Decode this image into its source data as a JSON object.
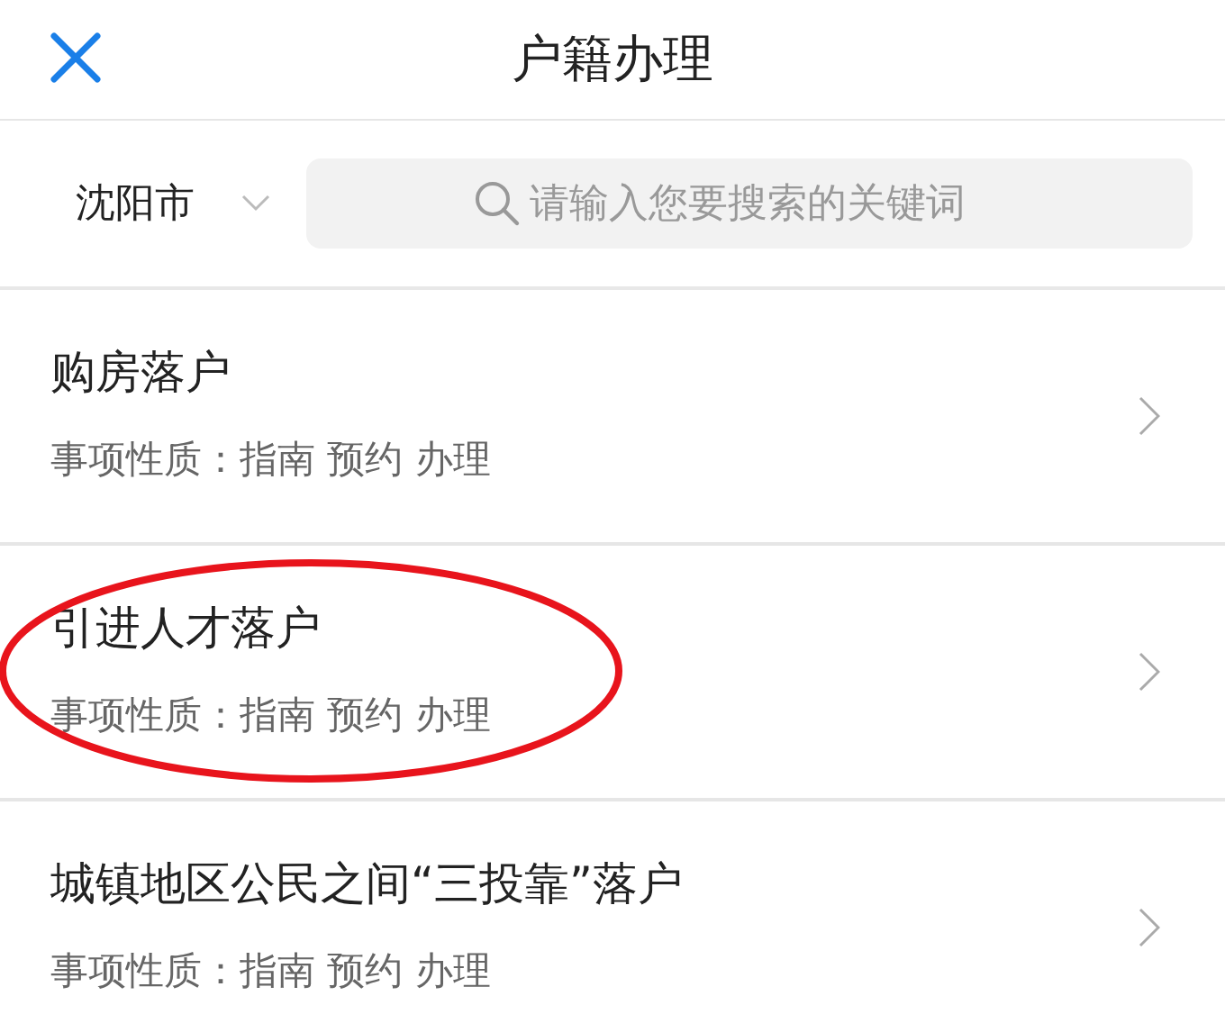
{
  "header": {
    "title": "户籍办理"
  },
  "filter": {
    "city": "沈阳市",
    "search_placeholder": "请输入您要搜索的关键词"
  },
  "items": [
    {
      "title": "购房落户",
      "subtitle": "事项性质：指南 预约 办理",
      "circled": false
    },
    {
      "title": "引进人才落户",
      "subtitle": "事项性质：指南 预约 办理",
      "circled": true
    },
    {
      "title": "城镇地区公民之间“三投靠”落户",
      "subtitle": "事项性质：指南 预约 办理",
      "circled": false
    }
  ]
}
